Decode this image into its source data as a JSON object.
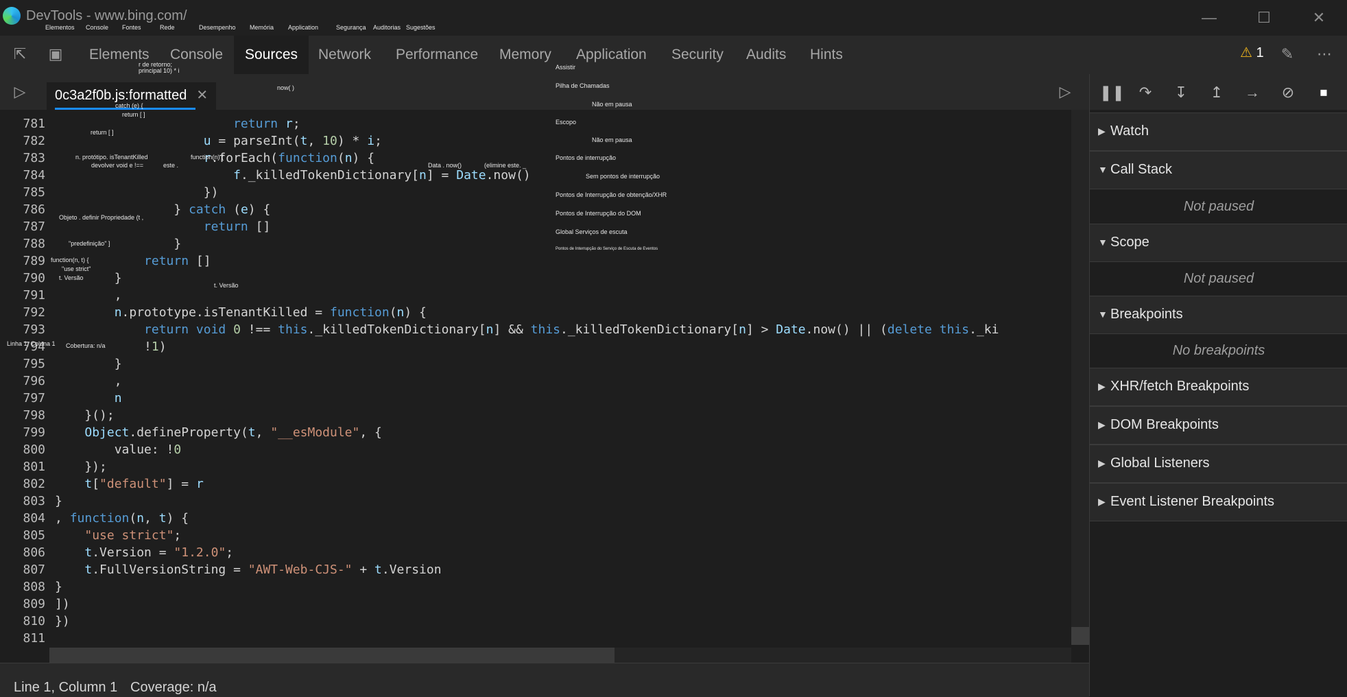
{
  "window": {
    "title": "DevTools - www.bing.com/"
  },
  "toolbar": {
    "inspect_icon": "select-element-icon",
    "device_icon": "device-emulation-icon",
    "tabs": [
      "Elements",
      "Console",
      "Sources",
      "Network",
      "Performance",
      "Memory",
      "Application",
      "Security",
      "Audits",
      "Hints"
    ],
    "active_tab": "Sources",
    "warning_count": "1"
  },
  "sources": {
    "file_tab": "0c3a2f0b.js:formatted"
  },
  "editor": {
    "lines": [
      "781",
      "782",
      "783",
      "784",
      "785",
      "786",
      "787",
      "788",
      "789",
      "790",
      "791",
      "792",
      "793",
      "794",
      "795",
      "796",
      "797",
      "798",
      "799",
      "800",
      "801",
      "802",
      "803",
      "804",
      "805",
      "806",
      "807",
      "808",
      "809",
      "810",
      "811"
    ]
  },
  "status": {
    "position": "Line 1, Column 1",
    "coverage": "Coverage: n/a"
  },
  "sidebar": {
    "watch": "Watch",
    "call_stack": "Call Stack",
    "call_stack_empty": "Not paused",
    "scope": "Scope",
    "scope_empty": "Not paused",
    "breakpoints": "Breakpoints",
    "breakpoints_empty": "No breakpoints",
    "xhr": "XHR/fetch Breakpoints",
    "dom": "DOM Breakpoints",
    "global": "Global Listeners",
    "event": "Event Listener Breakpoints"
  },
  "overlay": {
    "o1": "Elementos",
    "o2": "Console",
    "o3": "Fontes",
    "o4": "Rede",
    "o5": "Desempenho",
    "o6": "Memória",
    "o7": "Application",
    "o8": "Segurança",
    "o9": "Auditorias",
    "o10": "Sugestões",
    "o11": "r de retorno;",
    "o12": "principal 10) * i",
    "o13": "now( )",
    "o14": "catch (e) {",
    "o15": "return [ ]",
    "o16": "return [ ]",
    "o17": "n. protótipo. isTenantKilled",
    "o18": "function(n) {",
    "o19": "devolver void e !==",
    "o20": "este .",
    "o21": "Data . now()",
    "o22": "(elimine este. _",
    "o23": "Objeto . definir Propriedade (t ,",
    "o24": "\"predefinição\" ]",
    "o25": "function(n, t) {",
    "o26": "\"use strict\"",
    "o27": "t. Versão",
    "o28": "t. Versão",
    "o29": "Linha 1, Coluna 1",
    "o30": "Cobertura: n/a",
    "o31": "Assistir",
    "o32": "Pilha de Chamadas",
    "o33": "Não em pausa",
    "o34": "Escopo",
    "o35": "Não em pausa",
    "o36": "Pontos de interrupção",
    "o37": "Sem pontos de interrupção",
    "o38": "Pontos de Interrupção de obtenção/XHR",
    "o39": "Pontos de Interrupção do DOM",
    "o40": "Global   Serviços de escuta",
    "o41": "Pontos de Interrupção do Serviço de Escuta de Eventos"
  }
}
